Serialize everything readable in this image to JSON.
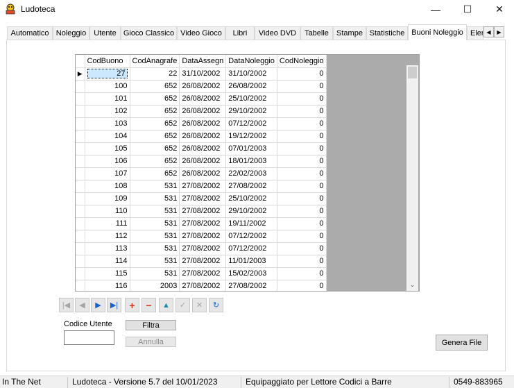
{
  "window": {
    "title": "Ludoteca",
    "minimize_glyph": "—",
    "maximize_glyph": "☐",
    "close_glyph": "✕",
    "icon": "game-app-icon"
  },
  "tabs": [
    {
      "label": "Automatico"
    },
    {
      "label": "Noleggio"
    },
    {
      "label": "Utente"
    },
    {
      "label": "Gioco Classico"
    },
    {
      "label": "Video Gioco"
    },
    {
      "label": "Libri"
    },
    {
      "label": "Video DVD"
    },
    {
      "label": "Tabelle"
    },
    {
      "label": "Stampe"
    },
    {
      "label": "Statistiche"
    },
    {
      "label": "Buoni Noleggio"
    },
    {
      "label": "Elen"
    }
  ],
  "active_tab": "Buoni Noleggio",
  "tab_scroll": {
    "left": "◀",
    "right": "▶"
  },
  "grid": {
    "columns": [
      "CodBuono",
      "CodAnagrafe",
      "DataAssegn",
      "DataNoleggio",
      "CodNoleggio"
    ],
    "current_row_marker": "▶",
    "rows": [
      [
        "27",
        "22",
        "31/10/2002",
        "31/10/2002",
        "0"
      ],
      [
        "100",
        "652",
        "26/08/2002",
        "26/08/2002",
        "0"
      ],
      [
        "101",
        "652",
        "26/08/2002",
        "25/10/2002",
        "0"
      ],
      [
        "102",
        "652",
        "26/08/2002",
        "29/10/2002",
        "0"
      ],
      [
        "103",
        "652",
        "26/08/2002",
        "07/12/2002",
        "0"
      ],
      [
        "104",
        "652",
        "26/08/2002",
        "19/12/2002",
        "0"
      ],
      [
        "105",
        "652",
        "26/08/2002",
        "07/01/2003",
        "0"
      ],
      [
        "106",
        "652",
        "26/08/2002",
        "18/01/2003",
        "0"
      ],
      [
        "107",
        "652",
        "26/08/2002",
        "22/02/2003",
        "0"
      ],
      [
        "108",
        "531",
        "27/08/2002",
        "27/08/2002",
        "0"
      ],
      [
        "109",
        "531",
        "27/08/2002",
        "25/10/2002",
        "0"
      ],
      [
        "110",
        "531",
        "27/08/2002",
        "29/10/2002",
        "0"
      ],
      [
        "111",
        "531",
        "27/08/2002",
        "19/11/2002",
        "0"
      ],
      [
        "112",
        "531",
        "27/08/2002",
        "07/12/2002",
        "0"
      ],
      [
        "113",
        "531",
        "27/08/2002",
        "07/12/2002",
        "0"
      ],
      [
        "114",
        "531",
        "27/08/2002",
        "11/01/2003",
        "0"
      ],
      [
        "115",
        "531",
        "27/08/2002",
        "15/02/2003",
        "0"
      ],
      [
        "116",
        "2003",
        "27/08/2002",
        "27/08/2002",
        "0"
      ]
    ],
    "scroll_down_glyph": "⌄"
  },
  "navigator": {
    "first": "|◀",
    "prev": "◀",
    "next": "▶",
    "last": "▶|",
    "add": "+",
    "delete": "−",
    "edit": "▲",
    "post": "✓",
    "cancel": "✕",
    "refresh": "↻"
  },
  "filter": {
    "label": "Codice Utente",
    "input_value": "",
    "filtra_label": "Filtra",
    "annulla_label": "Annulla"
  },
  "genera_label": "Genera File",
  "status": {
    "panel1": "In The Net",
    "panel2": "Ludoteca - Versione 5.7 del 10/01/2023",
    "panel3": "Equipaggiato per Lettore Codici a Barre",
    "panel4": "0549-883965"
  },
  "colors": {
    "selected_cell": "#cce8ff",
    "nav_blue": "#1a62c9",
    "nav_red": "#e0361a",
    "grid_background": "#ababab"
  }
}
